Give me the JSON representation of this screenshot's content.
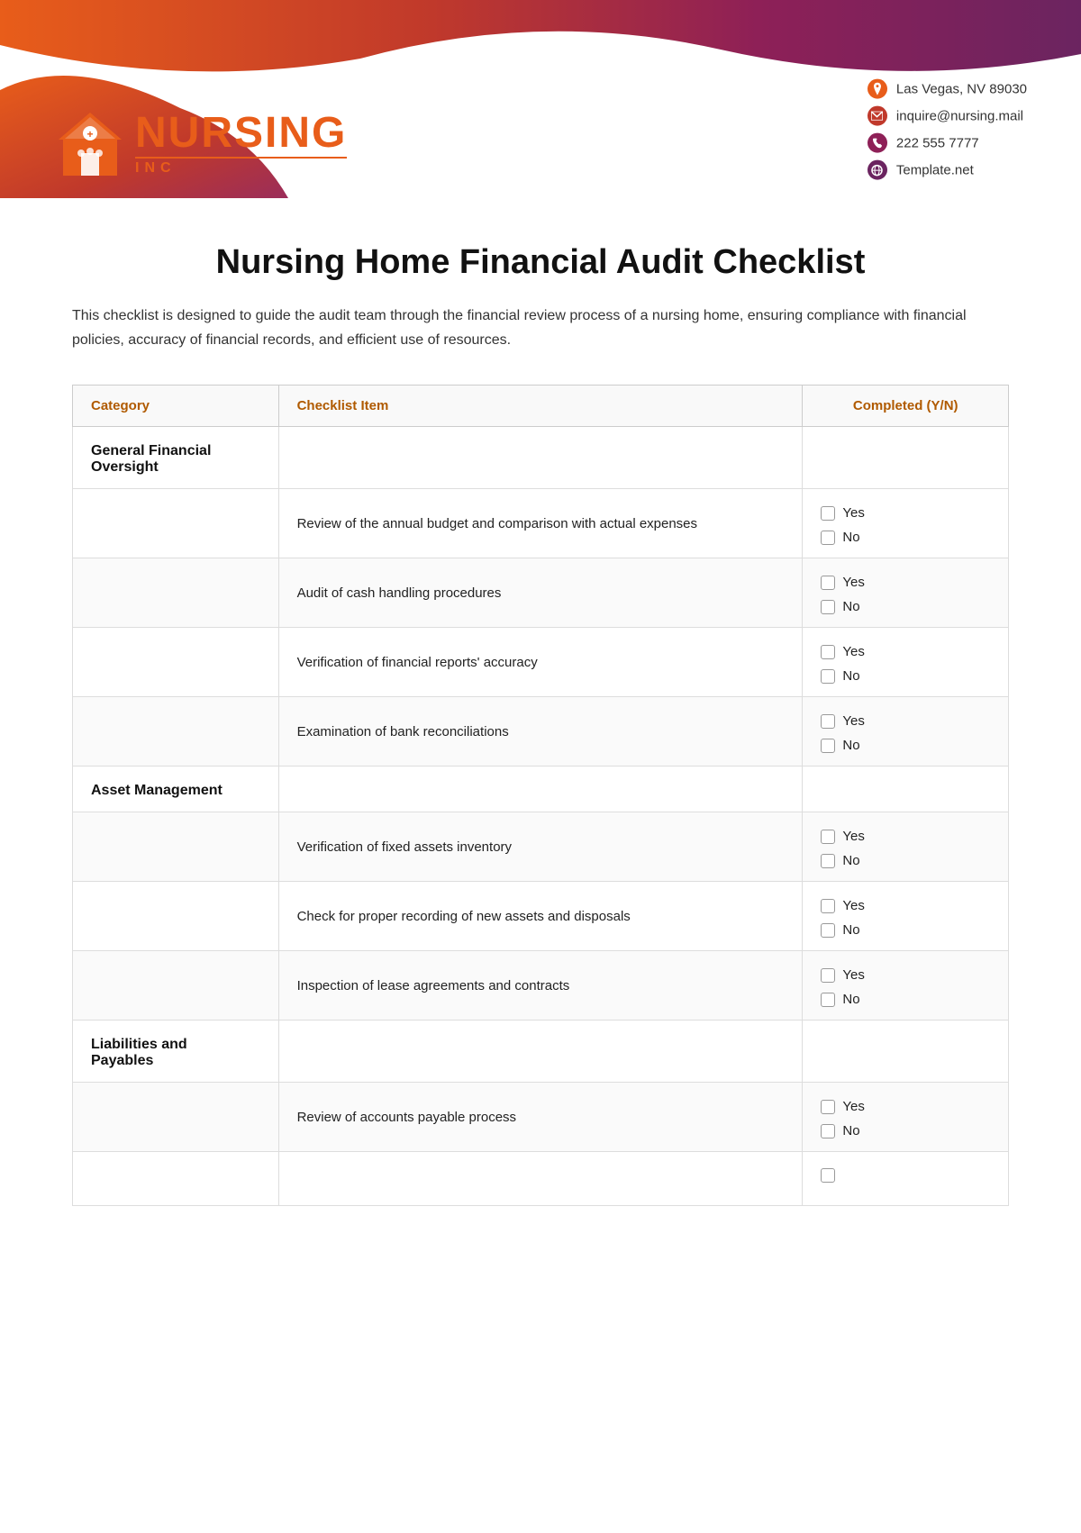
{
  "company": {
    "name": "NURSING",
    "inc": "INC",
    "tagline": "Template.net"
  },
  "contact": {
    "address": "Las Vegas, NV 89030",
    "email": "inquire@nursing.mail",
    "phone": "222 555 7777",
    "website": "Template.net"
  },
  "document": {
    "title": "Nursing Home Financial Audit Checklist",
    "description": "This checklist is designed to guide the audit team through the financial review process of a nursing home, ensuring compliance with financial policies, accuracy of financial records, and efficient use of resources."
  },
  "table": {
    "headers": [
      "Category",
      "Checklist Item",
      "Completed (Y/N)"
    ],
    "rows": [
      {
        "category": "General Financial\nOversight",
        "item": "",
        "yn": false
      },
      {
        "category": "",
        "item": "Review of the annual budget and comparison with actual expenses",
        "yn": true
      },
      {
        "category": "",
        "item": "Audit of cash handling procedures",
        "yn": true
      },
      {
        "category": "",
        "item": "Verification of financial reports' accuracy",
        "yn": true
      },
      {
        "category": "",
        "item": "Examination of bank reconciliations",
        "yn": true
      },
      {
        "category": "Asset Management",
        "item": "",
        "yn": false
      },
      {
        "category": "",
        "item": "Verification of fixed assets inventory",
        "yn": true
      },
      {
        "category": "",
        "item": "Check for proper recording of new assets and disposals",
        "yn": true
      },
      {
        "category": "",
        "item": "Inspection of lease agreements and contracts",
        "yn": true
      },
      {
        "category": "Liabilities and\nPayables",
        "item": "",
        "yn": false
      },
      {
        "category": "",
        "item": "Review of accounts payable process",
        "yn": true
      },
      {
        "category": "",
        "item": "...",
        "yn": true
      }
    ]
  },
  "yn_labels": {
    "yes": "Yes",
    "no": "No"
  }
}
